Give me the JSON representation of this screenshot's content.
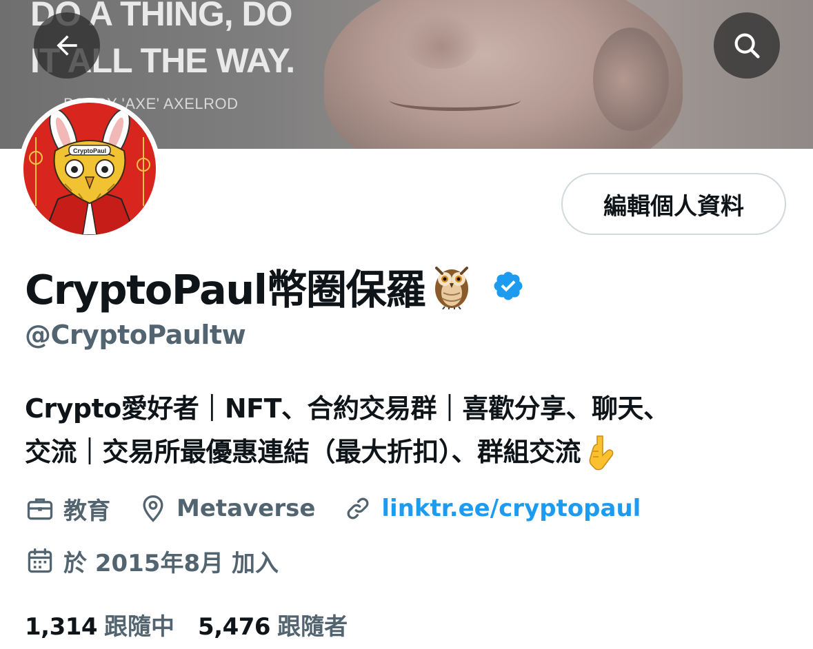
{
  "banner": {
    "quote": "DO A THING, DO\nIT ALL THE WAY.",
    "attribution": "BOBBY 'AXE' AXELROD"
  },
  "header": {
    "back_icon": "arrow-left-icon",
    "search_icon": "search-icon"
  },
  "profile": {
    "display_name": "CryptoPaul幣圈保羅",
    "name_emoji": "owl-emoji",
    "verified_icon": "verified-badge-icon",
    "handle": "@CryptoPaultw",
    "edit_button_label": "編輯個人資料",
    "bio_line1": "Crypto愛好者｜NFT、合約交易群｜喜歡分享、聊天、",
    "bio_line2": "交流｜交易所最優惠連結（最大折扣）、群組交流",
    "bio_emoji": "pointing-down-emoji",
    "category": "教育",
    "location": "Metaverse",
    "link": "linktr.ee/cryptopaul",
    "joined": "於 2015年8月 加入",
    "following_count": "1,314",
    "following_label": "跟隨中",
    "followers_count": "5,476",
    "followers_label": "跟隨者"
  },
  "colors": {
    "text_primary": "#0f1419",
    "text_secondary": "#536471",
    "link": "#1d9bf0",
    "button_border": "#cfd9de",
    "verified": "#1d9bf0"
  }
}
